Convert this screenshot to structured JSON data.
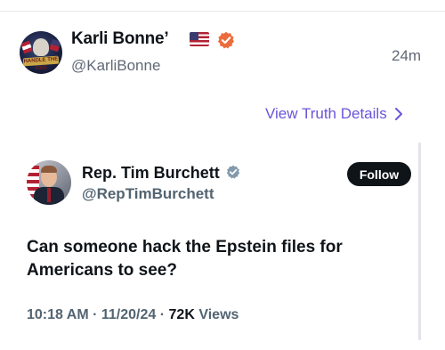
{
  "post": {
    "author_name": "Karli Bonne’",
    "author_handle": "@KarliBonne",
    "time_ago": "24m",
    "view_details_label": "View Truth Details",
    "avatar_banner_text": "HANDLE THE FIRE"
  },
  "embed": {
    "author_name": "Rep. Tim Burchett",
    "author_handle": "@RepTimBurchett",
    "follow_label": "Follow",
    "text": "Can someone hack the Epstein files for Americans to see?",
    "time": "10:18 AM",
    "date": "11/20/24",
    "views_count": "72K",
    "views_label": "Views"
  },
  "colors": {
    "accent_purple": "#6a55d9",
    "verified_orange": "#ec6b3c",
    "verified_gray": "#829aab",
    "text_primary": "#0f1419",
    "text_secondary": "#606876"
  },
  "icons": {
    "flag": "us-flag-icon",
    "verified_truth": "verified-badge-icon",
    "verified_x": "verified-gray-badge-icon",
    "chevron": "chevron-right-icon"
  }
}
